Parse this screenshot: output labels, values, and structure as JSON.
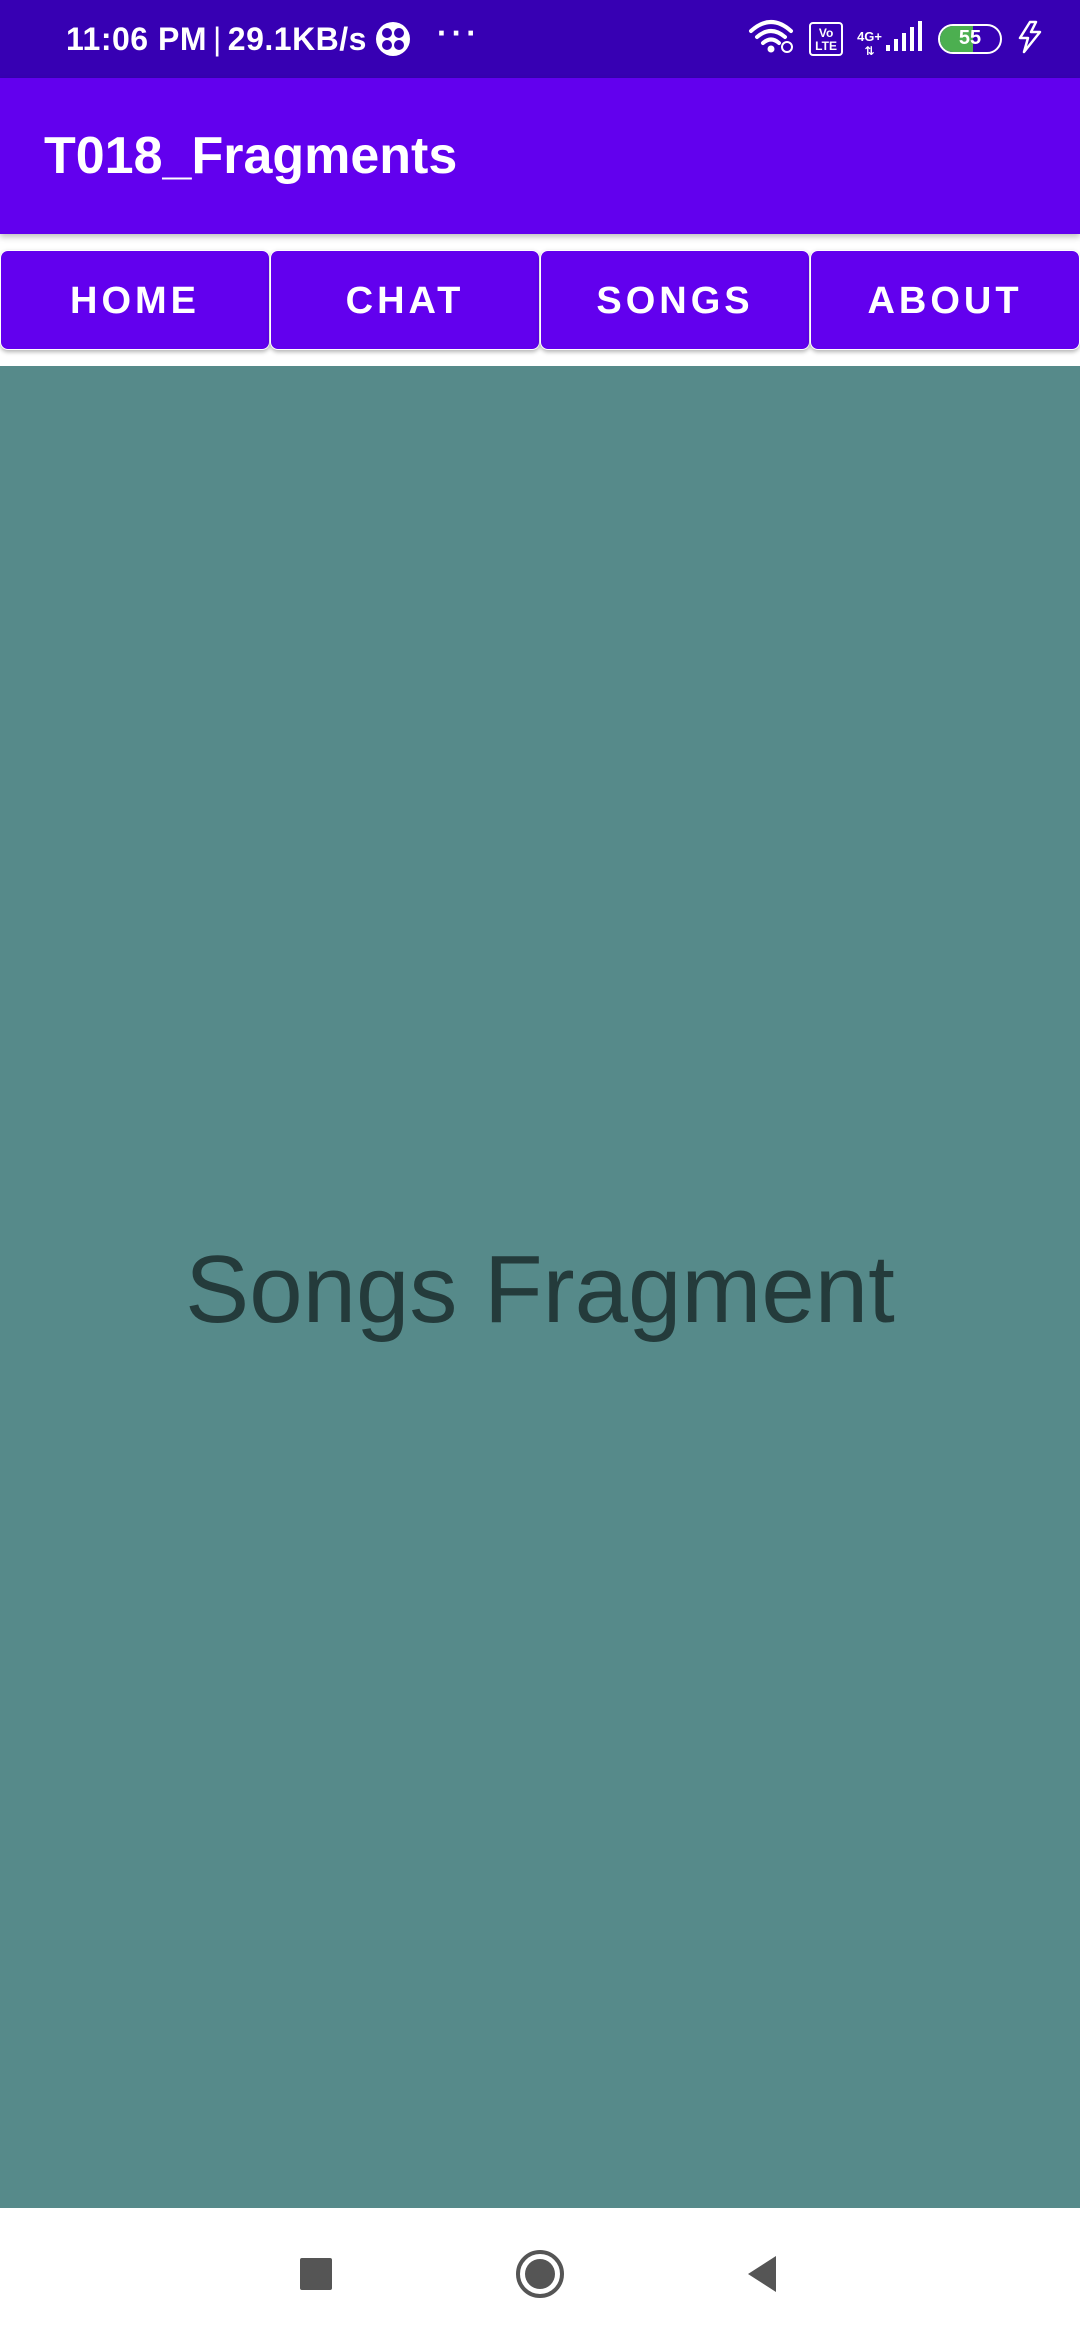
{
  "status_bar": {
    "time": "11:06 PM",
    "separator": "|",
    "net_speed": "29.1KB/s",
    "more_dots": "···",
    "volte_label_top": "Vo",
    "volte_label_bottom": "LTE",
    "network_type": "4G+",
    "battery_percent": "55",
    "battery_level": 0.55,
    "icons": [
      "app-notification-icon",
      "wifi-icon",
      "volte-icon",
      "signal-icon",
      "battery-icon",
      "charging-icon"
    ]
  },
  "app_bar": {
    "title": "T018_Fragments"
  },
  "tabs": [
    {
      "label": "HOME"
    },
    {
      "label": "CHAT"
    },
    {
      "label": "SONGS"
    },
    {
      "label": "ABOUT"
    }
  ],
  "fragment": {
    "text": "Songs Fragment"
  },
  "colors": {
    "status_bar": "#3700b3",
    "primary": "#6200ee",
    "fragment_bg": "#568a8a",
    "fragment_text": "#243b3b"
  },
  "nav_bar": {
    "icons": [
      "recents-square-icon",
      "home-circle-icon",
      "back-triangle-icon"
    ]
  }
}
